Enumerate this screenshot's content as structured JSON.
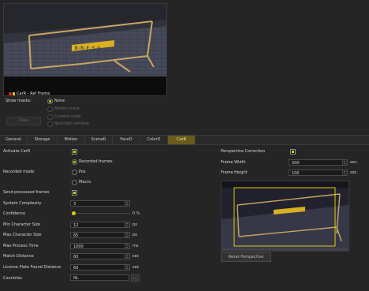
{
  "preview": {
    "caption": "CarR - Ref Frame",
    "plate_text": "B·R·E·S·5"
  },
  "masks": {
    "label": "Show masks:",
    "options": [
      {
        "label": "None",
        "selected": true,
        "enabled": true
      },
      {
        "label": "Motion mask",
        "selected": false,
        "enabled": false
      },
      {
        "label": "Current mask",
        "selected": false,
        "enabled": false
      },
      {
        "label": "Backlight window",
        "selected": false,
        "enabled": false
      }
    ],
    "clear_button": "Clear"
  },
  "tabs": [
    {
      "label": "General",
      "active": false
    },
    {
      "label": "Storage",
      "active": false
    },
    {
      "label": "Motion",
      "active": false
    },
    {
      "label": "SceneR",
      "active": false
    },
    {
      "label": "FaceD",
      "active": false
    },
    {
      "label": "ColorD",
      "active": false
    },
    {
      "label": "CarR",
      "active": true
    }
  ],
  "form": {
    "activate_label": "Activate CarR",
    "recorded_mode_label": "Recorded mode",
    "recorded_frames": "Recorded frames",
    "pos": "Pos",
    "macro": "Macro",
    "send_processed_label": "Send processed frames",
    "system_complexity_label": "System Complexity",
    "system_complexity_value": "3",
    "confidence_label": "Confidence",
    "confidence_value": "0",
    "confidence_unit": "%",
    "min_char_label": "Min Character Size",
    "min_char_value": "12",
    "max_char_label": "Max Character Size",
    "max_char_value": "65",
    "max_process_label": "Max Process Time",
    "max_process_value": "1000",
    "match_distance_label": "Match Distance",
    "match_distance_value": "60",
    "plate_distance_label": "License Plate Found Distance",
    "plate_distance_value": "60",
    "countries_label": "Countries",
    "countries_value": "NL",
    "browse_label": "...",
    "unit_px": "px",
    "unit_ms": "ms",
    "unit_sec": "sec"
  },
  "perspective": {
    "correction_label": "Perspective Correction",
    "frame_width_label": "Frame Width",
    "frame_width_value": "500",
    "frame_height_label": "Frame Height",
    "frame_height_value": "100",
    "unit": "sec.",
    "reset_button": "Reset Perspective"
  },
  "colors": {
    "accent": "#d8d000",
    "active_tab": "#6a5a1c",
    "background": "#252525",
    "record": "#d82020"
  }
}
